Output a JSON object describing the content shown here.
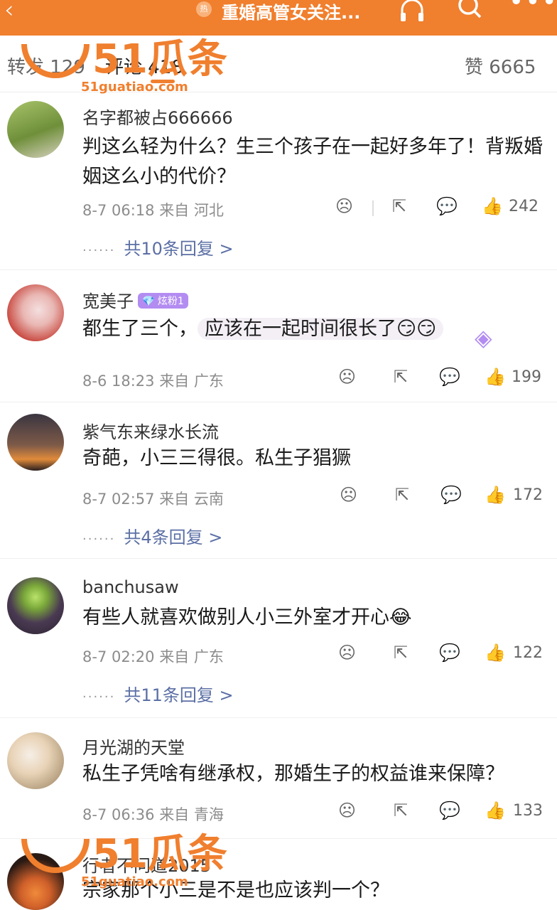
{
  "topbar": {
    "back_icon": "chevron-left-icon",
    "pill_text": "热",
    "title": "重婚高管女关注...",
    "listen_label": "听",
    "search_icon": "search-icon",
    "more_icon": "more-icon"
  },
  "tabs": {
    "repost": "转发 129",
    "comments": "评论 418",
    "likes": "赞 6665"
  },
  "comments": [
    {
      "username": "名字都被占666666",
      "text": "判这么轻为什么？生三个孩子在一起好多年了！背叛婚姻这么小的代价？",
      "time": "8-7 06:18",
      "location": "来自 河北",
      "likes": "242",
      "replies": "共10条回复 >"
    },
    {
      "username": "宽美子",
      "badge": "💎 炫粉1",
      "text_plain": "都生了三个，",
      "text_highlight": "应该在一起时间很长了😏😏",
      "time": "8-6 18:23",
      "location": "来自 广东",
      "likes": "199"
    },
    {
      "username": "紫气东来绿水长流",
      "text": "奇葩，小三三得很。私生子猖獗",
      "time": "8-7 02:57",
      "location": "来自 云南",
      "likes": "172",
      "replies": "共4条回复 >"
    },
    {
      "username": "banchusaw",
      "text": "有些人就喜欢做别人小三外室才开心😂",
      "time": "8-7 02:20",
      "location": "来自 广东",
      "likes": "122",
      "replies": "共11条回复 >"
    },
    {
      "username": "月光湖的天堂",
      "text": "私生子凭啥有继承权，那婚生子的权益谁来保障？",
      "time": "8-7 06:36",
      "location": "来自 青海",
      "likes": "133"
    },
    {
      "username": "行者不问道2015",
      "text": "宗家那个小三是不是也应该判一个？"
    }
  ],
  "actions": {
    "dislike_icon": "☹",
    "share_icon": "⇱",
    "reply_icon": "💬",
    "like_icon": "👍"
  },
  "watermark": {
    "big": "51瓜条",
    "small": "51guatiao.com"
  },
  "colors": {
    "accent": "#f07f2e",
    "reply_link": "#5b6fa5",
    "meta": "#8c8c8c"
  }
}
